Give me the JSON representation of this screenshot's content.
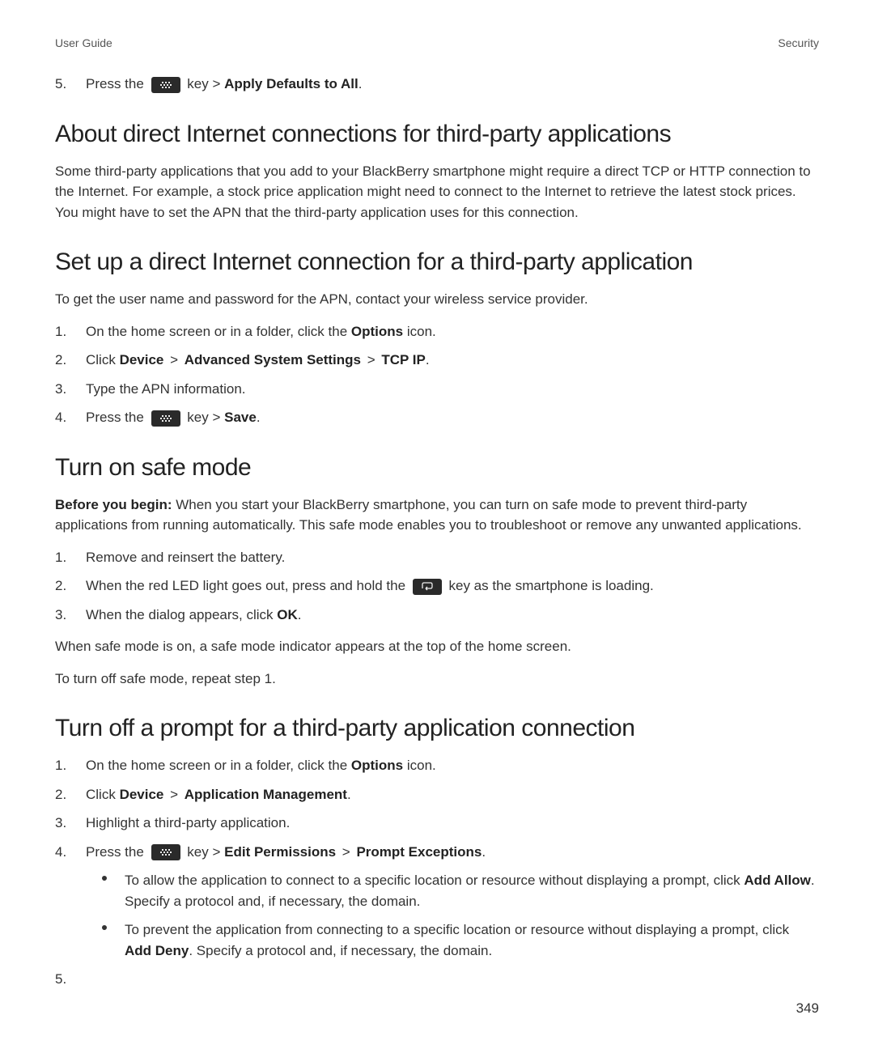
{
  "header": {
    "left": "User Guide",
    "right": "Security"
  },
  "step5top": {
    "num": "5.",
    "text_a": "Press the ",
    "text_b": " key > ",
    "bold": "Apply Defaults to All",
    "period": "."
  },
  "section1": {
    "heading": "About direct Internet connections for third-party applications",
    "para": "Some third-party applications that you add to your BlackBerry smartphone might require a direct TCP or HTTP connection to the Internet. For example, a stock price application might need to connect to the Internet to retrieve the latest stock prices. You might have to set the APN that the third-party application uses for this connection."
  },
  "section2": {
    "heading": "Set up a direct Internet connection for a third-party application",
    "intro": "To get the user name and password for the APN, contact your wireless service provider.",
    "steps": [
      {
        "num": "1.",
        "pre": "On the home screen or in a folder, click the ",
        "bold": "Options",
        "post": " icon."
      },
      {
        "num": "2.",
        "pre": "Click ",
        "b1": "Device",
        "gt1": " > ",
        "b2": "Advanced System Settings",
        "gt2": " > ",
        "b3": "TCP IP",
        "post": "."
      },
      {
        "num": "3.",
        "pre": "Type the APN information."
      },
      {
        "num": "4.",
        "pre": "Press the ",
        "icon": true,
        "mid": " key > ",
        "bold": "Save",
        "post": "."
      }
    ]
  },
  "section3": {
    "heading": "Turn on safe mode",
    "before_label": "Before you begin: ",
    "before_text": "When you start your BlackBerry smartphone, you can turn on safe mode to prevent third-party applications from running automatically. This safe mode enables you to troubleshoot or remove any unwanted applications.",
    "steps": {
      "s1": {
        "num": "1.",
        "text": "Remove and reinsert the battery."
      },
      "s2": {
        "num": "2.",
        "pre": "When the red LED light goes out, press and hold the ",
        "post": " key as the smartphone is loading."
      },
      "s3": {
        "num": "3.",
        "pre": "When the dialog appears, click ",
        "bold": "OK",
        "post": "."
      }
    },
    "outro1": "When safe mode is on, a safe mode indicator appears at the top of the home screen.",
    "outro2": "To turn off safe mode, repeat step 1."
  },
  "section4": {
    "heading": "Turn off a prompt for a third-party application connection",
    "steps": {
      "s1": {
        "num": "1.",
        "pre": "On the home screen or in a folder, click the ",
        "bold": "Options",
        "post": " icon."
      },
      "s2": {
        "num": "2.",
        "pre": "Click ",
        "b1": "Device",
        "gt": " > ",
        "b2": "Application Management",
        "post": "."
      },
      "s3": {
        "num": "3.",
        "text": "Highlight a third-party application."
      },
      "s4": {
        "num": "4.",
        "pre": "Press the ",
        "mid": " key > ",
        "b1": "Edit Permissions",
        "gt": " > ",
        "b2": "Prompt Exceptions",
        "post": "."
      }
    },
    "bullets": {
      "b1": {
        "pre": "To allow the application to connect to a specific location or resource without displaying a prompt, click ",
        "bold": "Add Allow",
        "post": ". Specify a protocol and, if necessary, the domain."
      },
      "b2": {
        "pre": "To prevent the application from connecting to a specific location or resource without displaying a prompt, click ",
        "bold": "Add Deny",
        "post": ". Specify a protocol and, if necessary, the domain."
      }
    },
    "s5num": "5."
  },
  "footer": {
    "page": "349"
  }
}
